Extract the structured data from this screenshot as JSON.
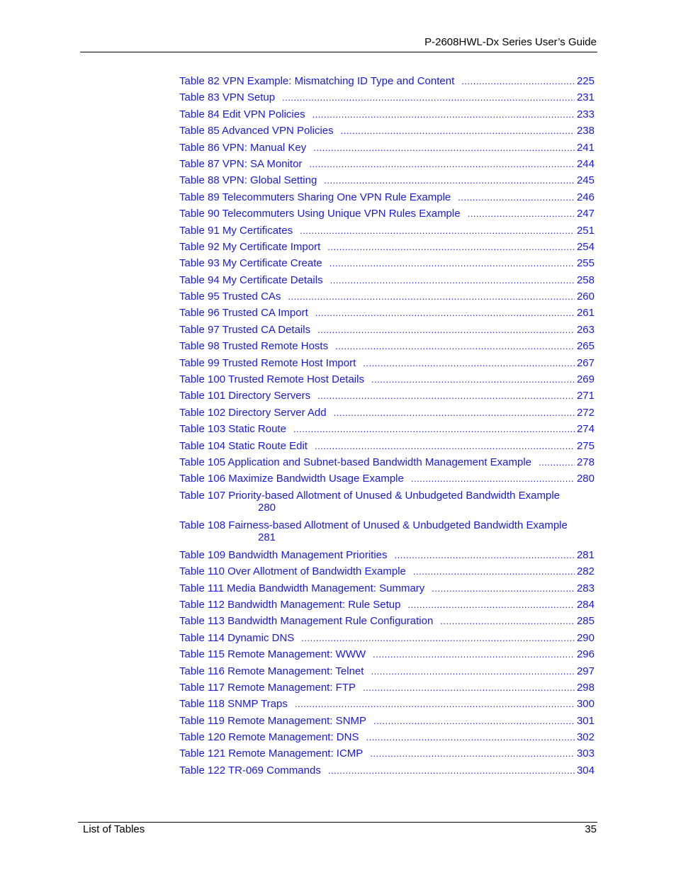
{
  "header": {
    "title": "P-2608HWL-Dx Series User’s Guide"
  },
  "toc": [
    {
      "title": "Table 82 VPN Example: Mismatching ID Type and Content",
      "page": "225"
    },
    {
      "title": "Table 83 VPN Setup",
      "page": "231"
    },
    {
      "title": "Table 84 Edit VPN Policies",
      "page": "233"
    },
    {
      "title": "Table 85 Advanced VPN Policies",
      "page": "238"
    },
    {
      "title": "Table 86 VPN: Manual Key",
      "page": "241"
    },
    {
      "title": "Table 87 VPN: SA Monitor",
      "page": "244"
    },
    {
      "title": "Table 88 VPN: Global Setting",
      "page": "245"
    },
    {
      "title": "Table 89 Telecommuters Sharing One VPN Rule Example",
      "page": "246"
    },
    {
      "title": "Table 90 Telecommuters Using Unique VPN Rules Example",
      "page": "247"
    },
    {
      "title": "Table 91 My Certificates",
      "page": "251"
    },
    {
      "title": "Table 92 My Certificate Import",
      "page": "254"
    },
    {
      "title": "Table 93 My Certificate Create",
      "page": "255"
    },
    {
      "title": "Table 94 My Certificate Details",
      "page": "258"
    },
    {
      "title": "Table 95 Trusted CAs",
      "page": "260"
    },
    {
      "title": "Table 96 Trusted CA Import",
      "page": "261"
    },
    {
      "title": "Table 97 Trusted CA Details",
      "page": "263"
    },
    {
      "title": "Table 98 Trusted Remote Hosts",
      "page": "265"
    },
    {
      "title": "Table 99 Trusted Remote Host Import",
      "page": "267"
    },
    {
      "title": "Table 100 Trusted Remote Host Details",
      "page": "269"
    },
    {
      "title": "Table 101 Directory Servers",
      "page": "271"
    },
    {
      "title": "Table 102 Directory Server Add",
      "page": "272"
    },
    {
      "title": "Table 103 Static Route",
      "page": "274"
    },
    {
      "title": "Table 104 Static Route Edit",
      "page": "275"
    },
    {
      "title": "Table 105 Application and Subnet-based Bandwidth Management Example",
      "page": "278"
    },
    {
      "title": "Table 106 Maximize Bandwidth Usage Example",
      "page": "280"
    },
    {
      "title": "Table 107 Priority-based Allotment of Unused & Unbudgeted Bandwidth Example",
      "page": "280",
      "wrap": true
    },
    {
      "title": "Table 108 Fairness-based Allotment of Unused & Unbudgeted Bandwidth Example",
      "page": "281",
      "wrap": true
    },
    {
      "title": "Table 109 Bandwidth Management Priorities",
      "page": "281"
    },
    {
      "title": "Table 110 Over Allotment of Bandwidth Example",
      "page": "282"
    },
    {
      "title": "Table 111 Media Bandwidth Management: Summary",
      "page": "283"
    },
    {
      "title": "Table 112 Bandwidth Management: Rule Setup",
      "page": "284"
    },
    {
      "title": "Table 113 Bandwidth Management Rule Configuration",
      "page": "285"
    },
    {
      "title": "Table 114 Dynamic DNS",
      "page": "290"
    },
    {
      "title": "Table 115 Remote Management: WWW",
      "page": "296"
    },
    {
      "title": "Table 116 Remote Management: Telnet",
      "page": "297"
    },
    {
      "title": "Table 117 Remote Management: FTP",
      "page": "298"
    },
    {
      "title": "Table 118 SNMP Traps",
      "page": "300"
    },
    {
      "title": "Table 119 Remote Management: SNMP",
      "page": "301"
    },
    {
      "title": "Table 120 Remote Management: DNS",
      "page": "302"
    },
    {
      "title": "Table 121 Remote Management: ICMP",
      "page": "303"
    },
    {
      "title": "Table 122 TR-069 Commands",
      "page": "304"
    }
  ],
  "footer": {
    "section": "List of Tables",
    "page_number": "35"
  },
  "colors": {
    "link": "#1a1adf",
    "text": "#000000"
  }
}
